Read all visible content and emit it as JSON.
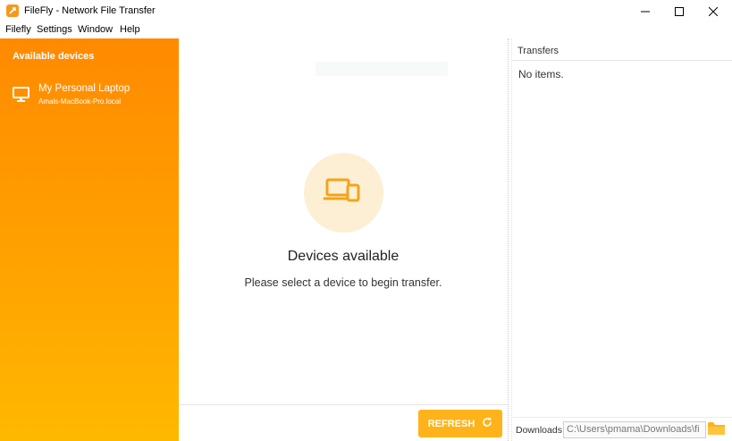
{
  "window": {
    "title": "FileFly - Network File Transfer",
    "controls": [
      "minimize",
      "maximize",
      "close"
    ]
  },
  "menu": [
    "Filefly",
    "Settings",
    "Window",
    "Help"
  ],
  "sidebar": {
    "title": "Available devices",
    "devices": [
      {
        "name": "My Personal Laptop",
        "host": "Amals-MacBook-Pro.local",
        "icon": "monitor-icon"
      }
    ]
  },
  "main": {
    "icon": "devices-icon",
    "heading": "Devices available",
    "subtext": "Please select a device to begin transfer.",
    "refresh_label": "REFRESH"
  },
  "transfers": {
    "title": "Transfers",
    "empty_text": "No items.",
    "downloads_label": "Downloads",
    "downloads_path": "C:\\Users\\pmama\\Downloads\\fi"
  },
  "colors": {
    "accent": "#ffb31a",
    "sidebar_top": "#ff8a00",
    "sidebar_bottom": "#ffb800",
    "icon_circle": "#fdefd4",
    "icon_stroke": "#f5a31a"
  }
}
